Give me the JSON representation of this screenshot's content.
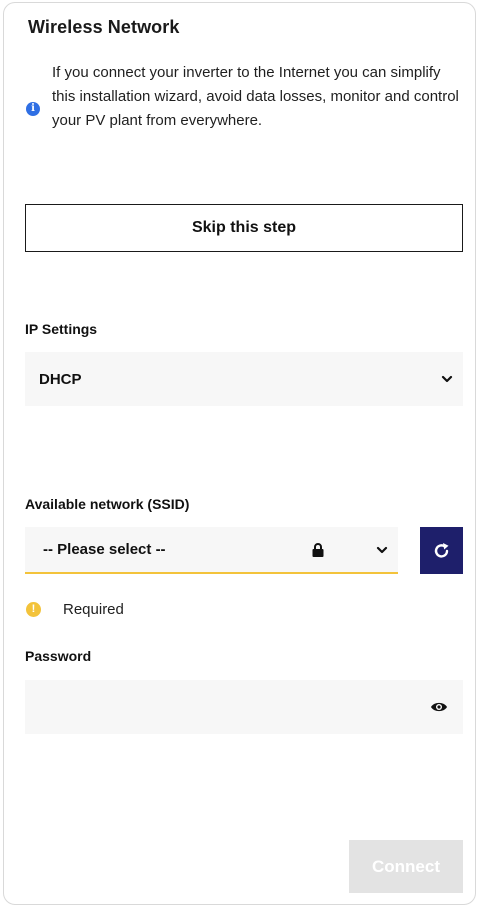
{
  "title": "Wireless Network",
  "info": {
    "icon": "info-icon",
    "text": "If you connect your inverter to the Internet you can simplify this installation wizard, avoid data losses, monitor and control your PV plant from everywhere."
  },
  "skip_button": "Skip this step",
  "ip_settings": {
    "label": "IP Settings",
    "selected": "DHCP"
  },
  "ssid": {
    "label": "Available network (SSID)",
    "selected": "-- Please select --",
    "required_text": "Required"
  },
  "password": {
    "label": "Password",
    "value": "",
    "placeholder": ""
  },
  "connect_button": "Connect",
  "colors": {
    "accent_navy": "#1e1f6b",
    "warning_yellow": "#f3c33b",
    "info_blue": "#2f6fe4",
    "disabled_gray": "#e3e3e3"
  }
}
